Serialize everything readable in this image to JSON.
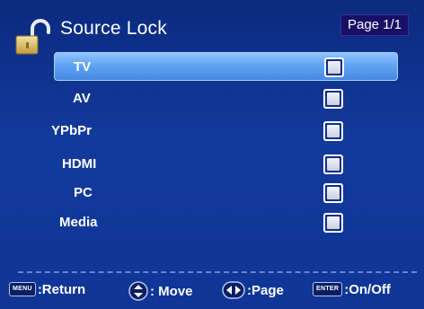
{
  "header": {
    "title": "Source Lock",
    "page_indicator": "Page 1/1"
  },
  "sources": [
    {
      "label": "TV",
      "selected": true
    },
    {
      "label": "AV",
      "selected": false
    },
    {
      "label": "YPbPr",
      "selected": false
    },
    {
      "label": "HDMI",
      "selected": false
    },
    {
      "label": "PC",
      "selected": false
    },
    {
      "label": "Media",
      "selected": false
    }
  ],
  "footer": {
    "menu_key": "MENU",
    "return_label": ":Return",
    "move_label": ": Move",
    "page_label": ":Page",
    "enter_key": "ENTER",
    "onoff_label": ":On/Off"
  },
  "colors": {
    "background": "#123a9c",
    "highlight": "#6aaaf5",
    "badge": "#1a0e66"
  },
  "icons": [
    "padlock-open-icon",
    "up-down-arrows-icon",
    "left-right-arrows-icon"
  ]
}
